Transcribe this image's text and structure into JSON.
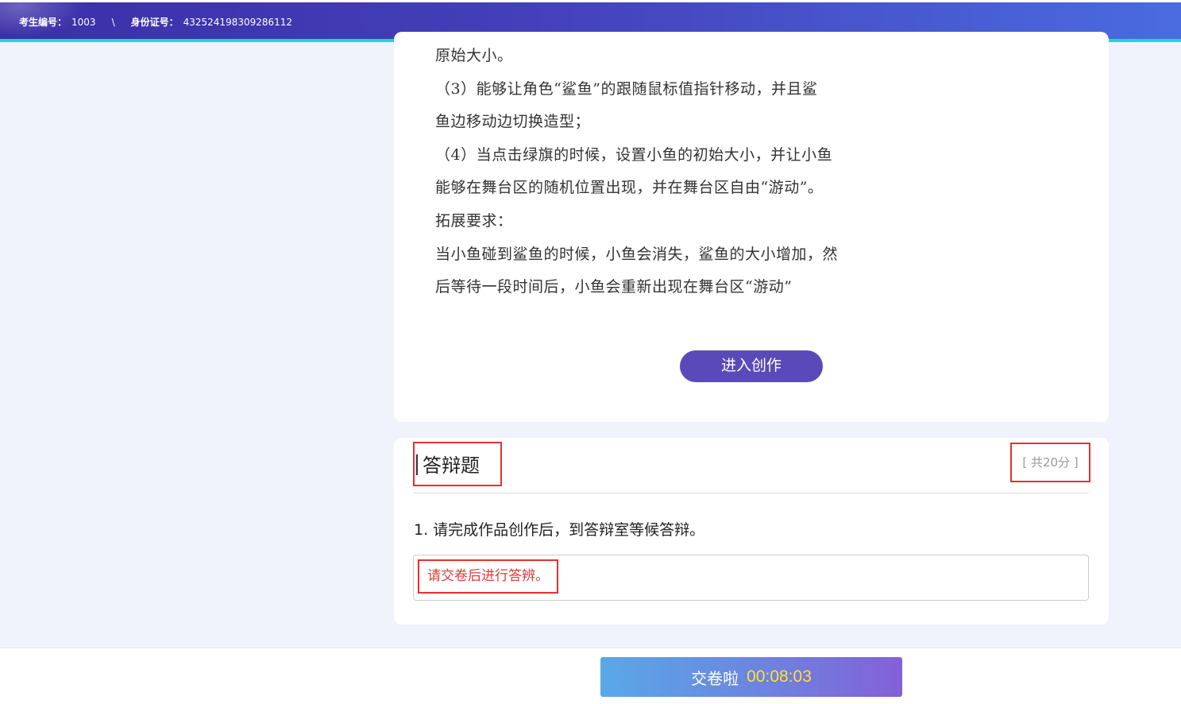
{
  "header": {
    "exam_no_label": "考生编号：",
    "exam_no": "1003",
    "separator": "\\",
    "id_label": "身份证号：",
    "id_no": "432524198309286112"
  },
  "task": {
    "lines": [
      "原始大小。",
      "（3）能够让角色“鲨鱼”的跟随鼠标值指针移动，并且鲨",
      "鱼边移动边切换造型；",
      "（4）当点击绿旗的时候，设置小鱼的初始大小，并让小鱼",
      "能够在舞台区的随机位置出现，并在舞台区自由“游动”。",
      "拓展要求：",
      "当小鱼碰到鲨鱼的时候，小鱼会消失，鲨鱼的大小增加，然",
      "后等待一段时间后，小鱼会重新出现在舞台区“游动”"
    ],
    "enter_button": "进入创作"
  },
  "defense": {
    "title": "答辩题",
    "score": "[ 共20分 ]",
    "question": "1. 请完成作品创作后，到答辩室等候答辩。",
    "answer_note": "请交卷后进行答辨。"
  },
  "footer": {
    "submit_label": "交卷啦",
    "timer": "00:08:03"
  },
  "colors": {
    "header_start": "#3b2fa7",
    "header_end": "#4b6be0",
    "header_accent": "#1fd7d0",
    "enter_button": "#5a49b8",
    "highlight_box": "#e53030",
    "timer": "#ffe033"
  }
}
